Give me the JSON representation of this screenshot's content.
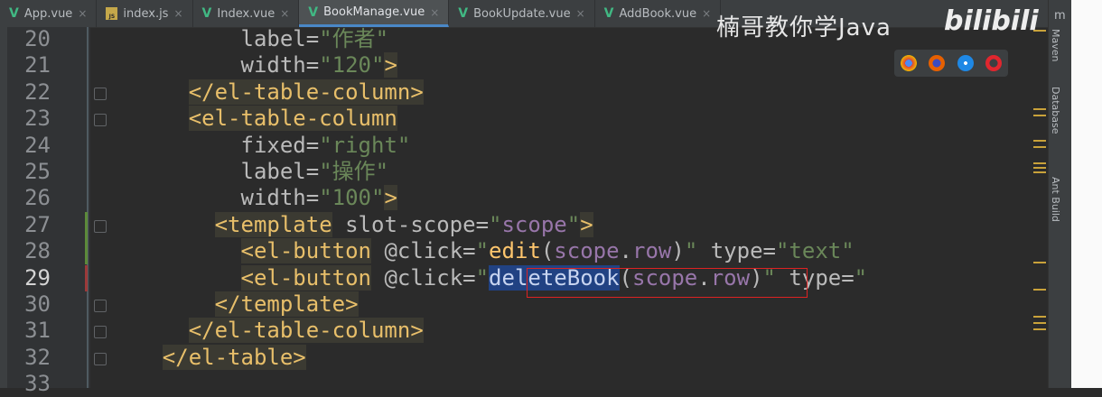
{
  "tabs": [
    {
      "label": "App.vue",
      "icon": "vue-icon"
    },
    {
      "label": "index.js",
      "icon": "js-file-icon"
    },
    {
      "label": "Index.vue",
      "icon": "vue-icon"
    },
    {
      "label": "BookManage.vue",
      "icon": "vue-icon",
      "active": true
    },
    {
      "label": "BookUpdate.vue",
      "icon": "vue-icon"
    },
    {
      "label": "AddBook.vue",
      "icon": "vue-icon"
    }
  ],
  "watermark": "楠哥教你学Java",
  "logo": "bilibili",
  "right_tools": [
    "Maven",
    "Database",
    "Ant Build"
  ],
  "right_corner": "m",
  "lines": [
    {
      "num": "20",
      "parts": [
        [
          "attr",
          "label="
        ],
        [
          "str",
          "\"作者\""
        ]
      ]
    },
    {
      "num": "21",
      "parts": [
        [
          "attr",
          "width="
        ],
        [
          "str",
          "\"120\""
        ],
        [
          "tag",
          ">"
        ]
      ]
    },
    {
      "num": "22",
      "parts": [
        [
          "tag",
          "</el-table-column>"
        ]
      ]
    },
    {
      "num": "23",
      "parts": [
        [
          "tag",
          "<el-table-column"
        ]
      ]
    },
    {
      "num": "24",
      "parts": [
        [
          "attr",
          "fixed="
        ],
        [
          "str",
          "\"right\""
        ]
      ]
    },
    {
      "num": "25",
      "parts": [
        [
          "attr",
          "label="
        ],
        [
          "str",
          "\"操作\""
        ]
      ]
    },
    {
      "num": "26",
      "parts": [
        [
          "attr",
          "width="
        ],
        [
          "str",
          "\"100\""
        ],
        [
          "tag",
          ">"
        ]
      ]
    },
    {
      "num": "27",
      "parts": [
        [
          "tag",
          "<template"
        ],
        [
          "attr",
          " slot-scope="
        ],
        [
          "str",
          "\""
        ],
        [
          "kw",
          "scope"
        ],
        [
          "str",
          "\""
        ],
        [
          "tag",
          ">"
        ]
      ]
    },
    {
      "num": "28",
      "parts": [
        [
          "tag",
          "<el-button"
        ],
        [
          "attr",
          " @click="
        ],
        [
          "str",
          "\""
        ],
        [
          "fn",
          "edit"
        ],
        [
          "attr",
          "("
        ],
        [
          "kw",
          "scope"
        ],
        [
          "attr",
          "."
        ],
        [
          "kw",
          "row"
        ],
        [
          "attr",
          ")"
        ],
        [
          "str",
          "\""
        ],
        [
          "attr",
          " type="
        ],
        [
          "str",
          "\"text\""
        ]
      ]
    },
    {
      "num": "29",
      "parts": [
        [
          "tag",
          "<el-button"
        ],
        [
          "attr",
          " @click="
        ],
        [
          "str",
          "\""
        ],
        [
          "hl",
          "deleteBook"
        ],
        [
          "attr",
          "("
        ],
        [
          "kw",
          "scope"
        ],
        [
          "attr",
          "."
        ],
        [
          "kw",
          "row"
        ],
        [
          "attr",
          ")"
        ],
        [
          "str",
          "\""
        ],
        [
          "attr",
          " type="
        ],
        [
          "str",
          "\""
        ]
      ]
    },
    {
      "num": "30",
      "parts": [
        [
          "tag",
          "</template>"
        ]
      ]
    },
    {
      "num": "31",
      "parts": [
        [
          "tag",
          "</el-table-column>"
        ]
      ]
    },
    {
      "num": "32",
      "parts": [
        [
          "tag",
          "</el-table>"
        ]
      ]
    },
    {
      "num": "33",
      "parts": []
    }
  ]
}
